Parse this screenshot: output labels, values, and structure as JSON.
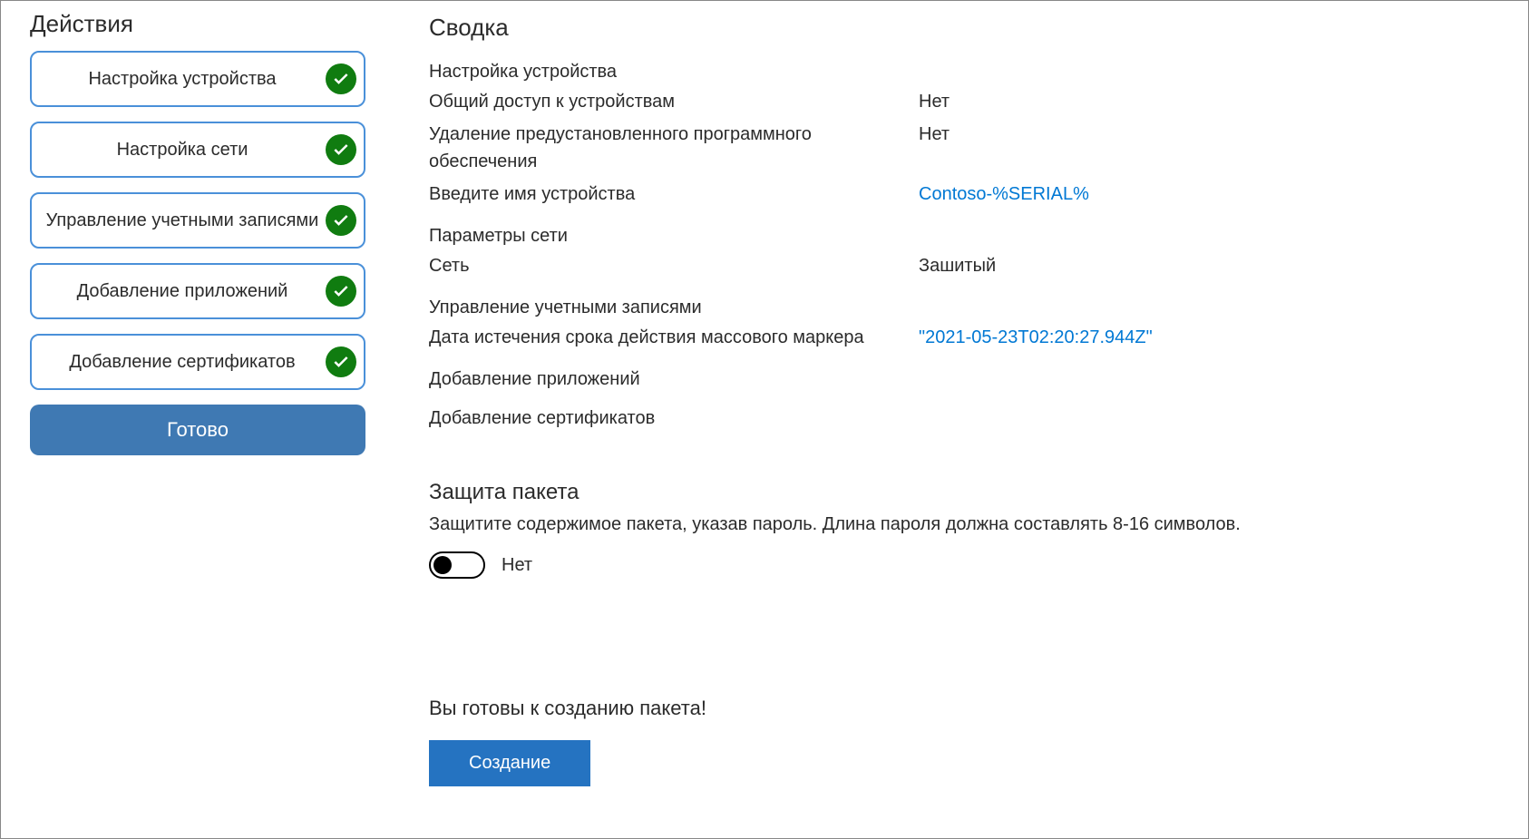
{
  "sidebar": {
    "title": "Действия",
    "steps": [
      {
        "label": "Настройка устройства"
      },
      {
        "label": "Настройка сети"
      },
      {
        "label": "Управление учетными записями"
      },
      {
        "label": "Добавление приложений"
      },
      {
        "label": "Добавление сертификатов"
      }
    ],
    "ready_label": "Готово"
  },
  "summary": {
    "title": "Сводка",
    "device_setup": {
      "heading": "Настройка устройства",
      "shared_label": "Общий доступ к устройствам",
      "shared_value": "Нет",
      "remove_sw_label": "Удаление предустановленного программного обеспечения",
      "remove_sw_value": "Нет",
      "device_name_label": "Введите имя устройства",
      "device_name_value": "Contoso-%SERIAL%"
    },
    "network": {
      "heading": "Параметры сети",
      "net_label": "Сеть",
      "net_value": "Зашитый"
    },
    "accounts": {
      "heading": "Управление учетными записями",
      "token_label": "Дата истечения срока действия массового маркера",
      "token_value": "\"2021-05-23T02:20:27.944Z\""
    },
    "apps_heading": "Добавление приложений",
    "certs_heading": "Добавление сертификатов"
  },
  "protect": {
    "heading": "Защита пакета",
    "description": "Защитите содержимое пакета, указав пароль. Длина пароля должна составлять 8-16 символов.",
    "toggle_label": "Нет"
  },
  "ready": {
    "text": "Вы готовы к созданию пакета!",
    "create_label": "Создание"
  }
}
